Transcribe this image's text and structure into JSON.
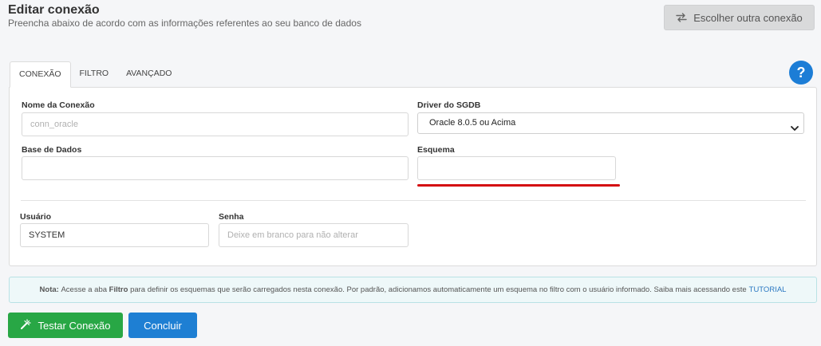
{
  "header": {
    "title": "Editar conexão",
    "subtitle": "Preencha abaixo de acordo com as informações referentes ao seu banco de dados",
    "choose_label": "Escolher outra conexão"
  },
  "tabs": [
    {
      "label": "CONEXÃO",
      "active": true
    },
    {
      "label": "FILTRO",
      "active": false
    },
    {
      "label": "AVANÇADO",
      "active": false
    }
  ],
  "help_label": "?",
  "form": {
    "connection_name": {
      "label": "Nome da Conexão",
      "value": "",
      "placeholder": "conn_oracle"
    },
    "driver": {
      "label": "Driver do SGDB",
      "value": "Oracle 8.0.5 ou Acima"
    },
    "database": {
      "label": "Base de Dados",
      "value": "",
      "placeholder": ""
    },
    "schema": {
      "label": "Esquema",
      "value": "",
      "placeholder": ""
    },
    "user": {
      "label": "Usuário",
      "value": "SYSTEM",
      "placeholder": ""
    },
    "password": {
      "label": "Senha",
      "value": "",
      "placeholder": "Deixe em branco para não alterar"
    }
  },
  "note": {
    "prefix": "Nota:",
    "text1": "Acesse a aba",
    "bold": "Filtro",
    "text2": "para definir os esquemas que serão carregados nesta conexão. Por padrão, adicionamos automaticamente um esquema no filtro com o usuário informado. Saiba mais acessando este",
    "link": "TUTORIAL"
  },
  "buttons": {
    "test": "Testar Conexão",
    "done": "Concluir"
  },
  "colors": {
    "primary": "#1e7fd3",
    "success": "#28a745",
    "highlight": "#d40d12"
  }
}
